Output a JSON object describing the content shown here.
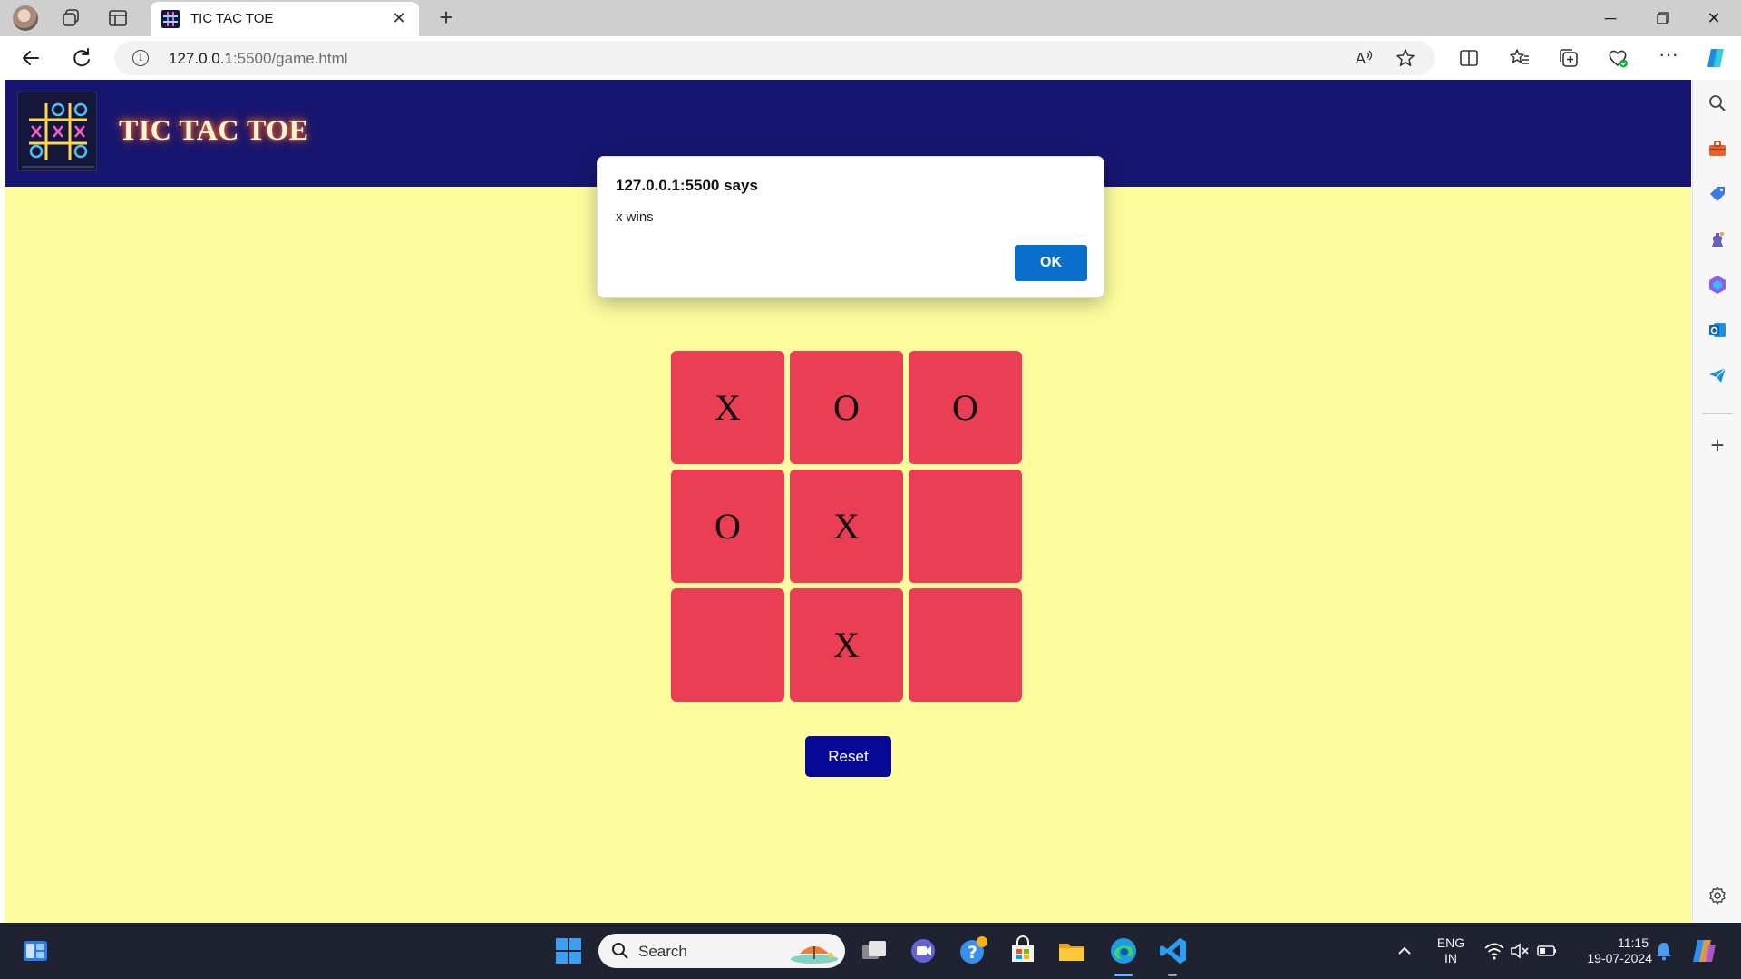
{
  "browser": {
    "tab_title": "TIC TAC TOE",
    "url_host": "127.0.0.1",
    "url_rest": ":5500/game.html"
  },
  "page": {
    "brand": "TIC TAC TOE",
    "title": "TIC TAC TOE",
    "board": [
      "X",
      "O",
      "O",
      "O",
      "X",
      "",
      "",
      "X",
      ""
    ],
    "reset_label": "Reset",
    "colors": {
      "background": "#fdfd9f",
      "header": "#161670",
      "cell": "#ea3e55",
      "reset": "#080896"
    }
  },
  "dialog": {
    "title": "127.0.0.1:5500 says",
    "message": "x wins",
    "ok_label": "OK"
  },
  "taskbar": {
    "search_label": "Search",
    "lang_line1": "ENG",
    "lang_line2": "IN",
    "time": "11:15",
    "date": "19-07-2024"
  }
}
